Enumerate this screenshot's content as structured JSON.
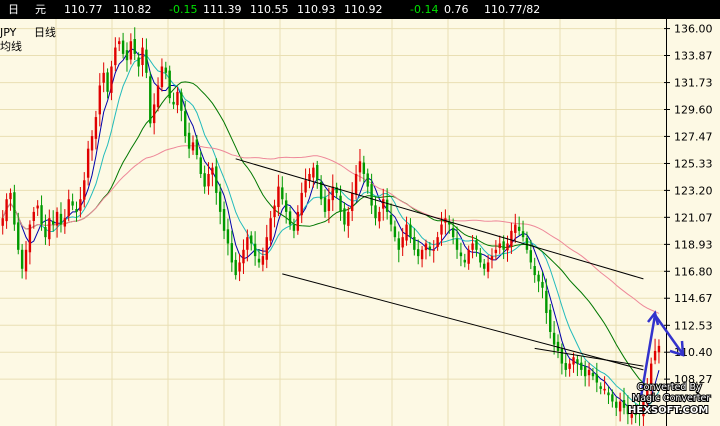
{
  "quote_bar": {
    "period": "日",
    "currency": "元",
    "open": "110.77",
    "high": "110.82",
    "change": "-0.15",
    "v1": "111.39",
    "v2": "110.55",
    "v3": "110.93",
    "v4": "110.92",
    "change2": "-0.14",
    "pct": "0.76",
    "bidask": "110.77/82"
  },
  "chart_labels": {
    "symbol": "JPY",
    "timeframe": "日线",
    "indicator": "均线",
    "watermark": [
      "Converted By",
      "Magic Converter",
      "HEXSOFT.COM"
    ]
  },
  "colors": {
    "background": "#fdf9e4",
    "grid": "#e9dfb3",
    "axis_panel": "#fdf9e4",
    "candle_up": "#e00000",
    "candle_down": "#009900",
    "ma_short": "#0000aa",
    "ma_medium": "#22bbbb",
    "ma_long": "#007700",
    "ma_longer": "#ee8899",
    "channel": "#000000",
    "arrow": "#3333cc"
  },
  "chart_data": {
    "type": "candlestick",
    "ylim": [
      104.8,
      136.6
    ],
    "y_ticks": [
      "136.00",
      "133.87",
      "131.73",
      "129.60",
      "127.47",
      "125.33",
      "123.20",
      "121.07",
      "118.93",
      "116.80",
      "114.67",
      "112.53",
      "110.40",
      "108.27"
    ],
    "closes": [
      121,
      122.5,
      123,
      120.5,
      118.5,
      117,
      118.5,
      120.5,
      121.5,
      122,
      120.5,
      119.5,
      121,
      120.5,
      121.5,
      120.5,
      121,
      122.5,
      122,
      121.5,
      122.5,
      124,
      126.5,
      127.5,
      129,
      131.5,
      132.5,
      131,
      133,
      134.5,
      135,
      134,
      133.5,
      135,
      134,
      133,
      134.5,
      132.5,
      128.5,
      130,
      131.5,
      133,
      132.5,
      130.5,
      130,
      131,
      129.5,
      127.5,
      126.5,
      127,
      126,
      124.5,
      123.5,
      124.5,
      125,
      123,
      121.5,
      120,
      119,
      117.5,
      116.5,
      117.5,
      118.5,
      119.5,
      119,
      118,
      117.5,
      118,
      119.5,
      121,
      122,
      123.5,
      122.5,
      121.5,
      120.5,
      120,
      121.5,
      123,
      124,
      124.5,
      125,
      124,
      122.5,
      121.5,
      122.5,
      123.5,
      123,
      121.5,
      120.5,
      121.5,
      123,
      124.5,
      125.5,
      124.5,
      123.5,
      122,
      121,
      121.5,
      122.5,
      121.5,
      120.5,
      119.5,
      118.5,
      119.5,
      120.5,
      119.5,
      118.5,
      118,
      118.5,
      119,
      118.5,
      118.5,
      119.5,
      120.5,
      121,
      120.5,
      119.5,
      118.5,
      118,
      117.5,
      118.5,
      119,
      118.5,
      117.5,
      117,
      117.5,
      118,
      118.5,
      119,
      118.5,
      119,
      120,
      120.5,
      120,
      119.5,
      118.5,
      117.5,
      116.5,
      116,
      115.5,
      113.5,
      112,
      111,
      110.5,
      109.5,
      109,
      109.5,
      110,
      109.5,
      109,
      108.5,
      109,
      108.5,
      108,
      107.5,
      107.5,
      107,
      106.5,
      106,
      106.5,
      106,
      105.5,
      105.5,
      105.5,
      105.5,
      106.5,
      107.5,
      109.5,
      110.5,
      110.9
    ],
    "moving_averages": [
      {
        "name": "MA-short",
        "period": 5
      },
      {
        "name": "MA-medium",
        "period": 10
      },
      {
        "name": "MA-long",
        "period": 25
      },
      {
        "name": "MA-longer",
        "period": 60
      }
    ],
    "trend_channel": {
      "upper": [
        [
          60,
          125.7
        ],
        [
          165,
          116.2
        ]
      ],
      "lower": [
        [
          72,
          116.6
        ],
        [
          165,
          109.0
        ]
      ],
      "inner_line": [
        [
          137,
          110.7
        ],
        [
          165,
          109.3
        ]
      ]
    }
  }
}
